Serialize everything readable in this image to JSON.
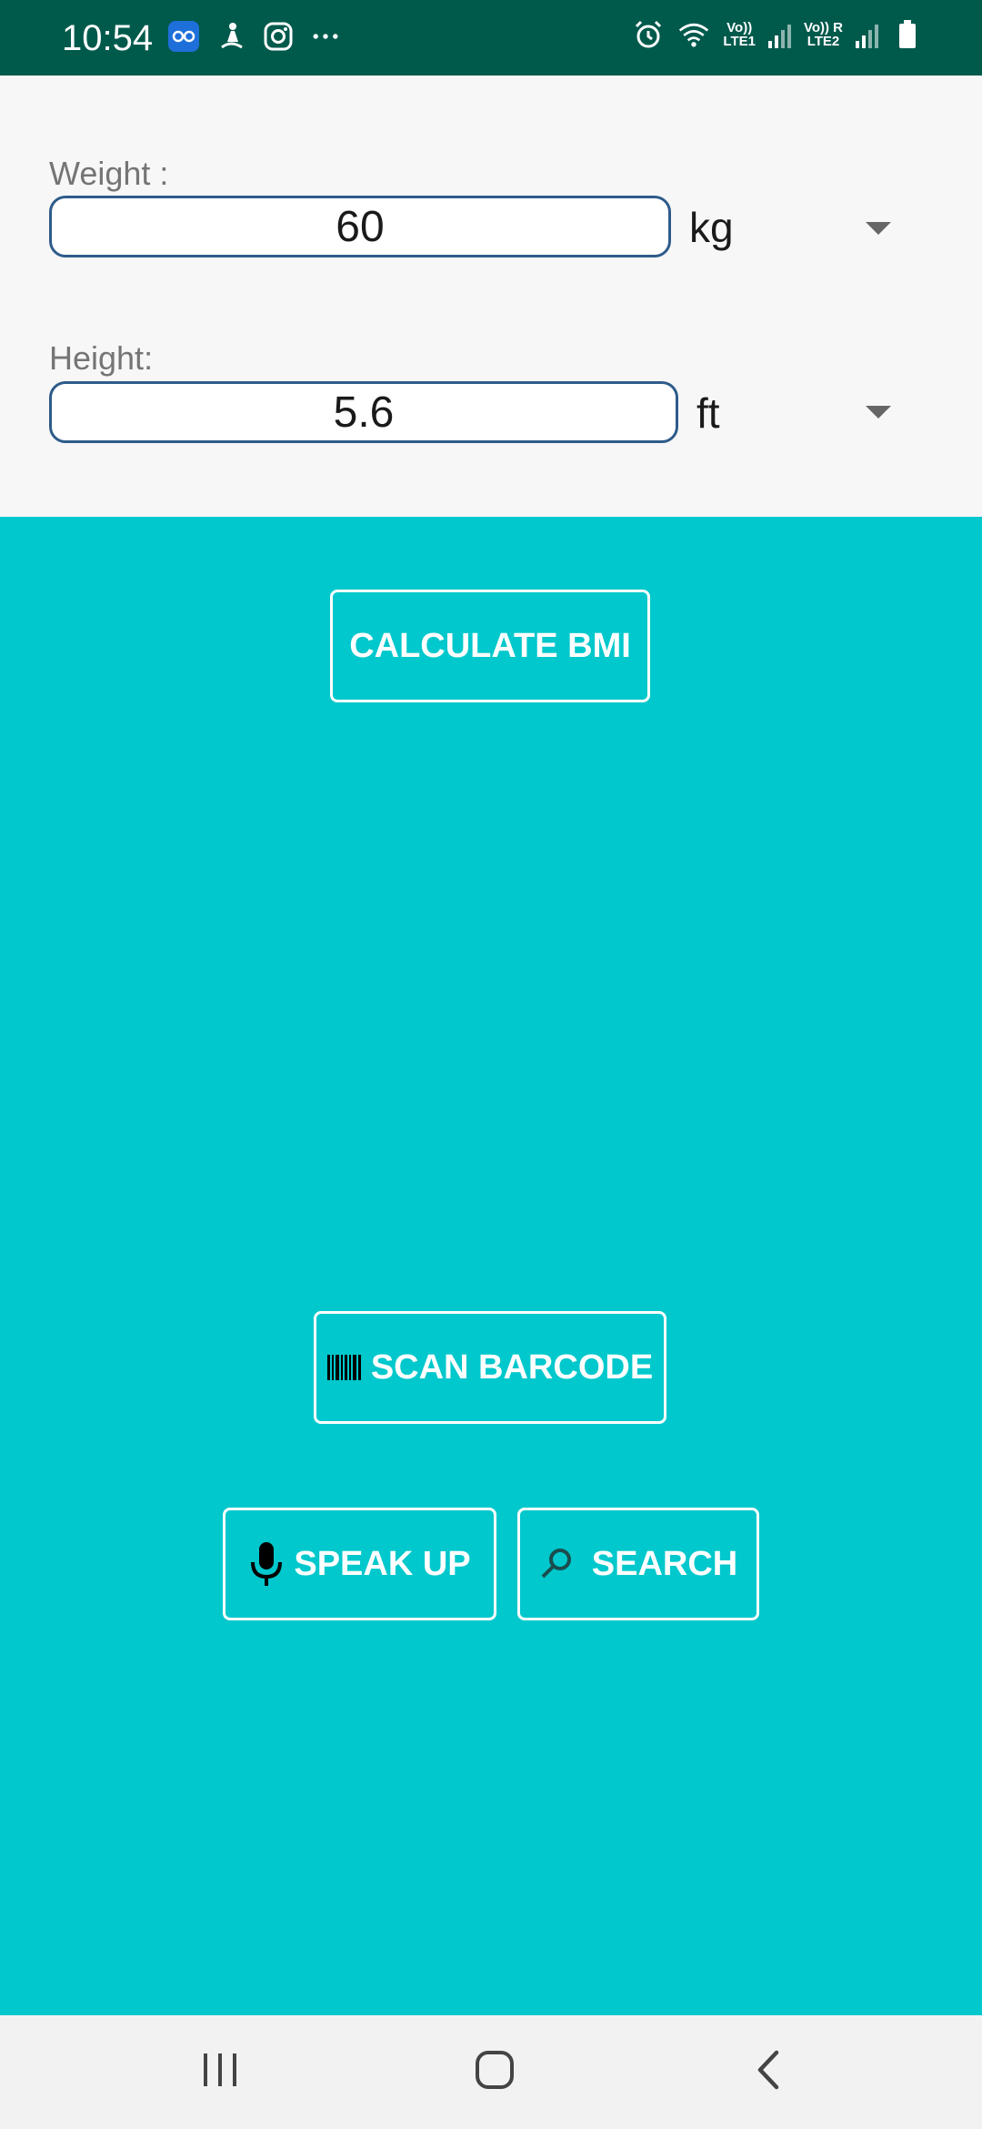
{
  "status_bar": {
    "time": "10:54",
    "left_icons": [
      "glasses-app-icon",
      "yoga-app-icon",
      "instagram-icon",
      "more-dots-icon"
    ],
    "sim1_label": "Vo))\nLTE1",
    "sim2_label": "Vo)) R\nLTE2",
    "right_icons": [
      "alarm-icon",
      "wifi-icon",
      "signal-icon",
      "battery-icon"
    ]
  },
  "form": {
    "weight": {
      "label": "Weight :",
      "value": "60",
      "unit": "kg"
    },
    "height": {
      "label": "Height:",
      "value": "5.6",
      "unit": "ft"
    }
  },
  "actions": {
    "calculate_label": "CALCULATE BMI",
    "scan_label": "SCAN BARCODE",
    "speak_label": "SPEAK UP",
    "search_label": "SEARCH"
  },
  "colors": {
    "status_bar_bg": "#005A4C",
    "form_bg": "#F7F7F7",
    "main_bg": "#00C8CC",
    "input_border": "#2E5C8A",
    "nav_bg": "#F2F2F2"
  },
  "nav": {
    "icons": [
      "recent-apps-icon",
      "home-icon",
      "back-icon"
    ]
  }
}
